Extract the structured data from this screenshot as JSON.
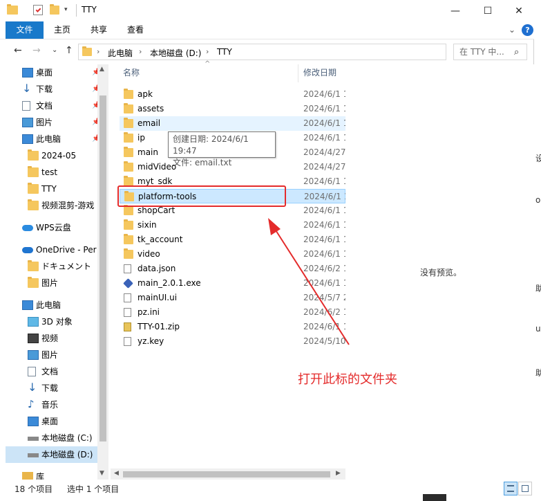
{
  "window": {
    "title": "TTY",
    "controls": {
      "minimize": "—",
      "maximize": "☐",
      "close": "✕"
    }
  },
  "ribbon": {
    "tabs": [
      {
        "label": "文件",
        "active": true
      },
      {
        "label": "主页",
        "active": false
      },
      {
        "label": "共享",
        "active": false
      },
      {
        "label": "查看",
        "active": false
      }
    ],
    "expand": "⌄",
    "help": "?"
  },
  "address": {
    "back": "←",
    "forward": "→",
    "recent": "⌄",
    "up": "↑",
    "breadcrumbs": [
      "此电脑",
      "本地磁盘 (D:)",
      "TTY"
    ],
    "separator": "›",
    "dropdown": "⌄",
    "refresh": "↻",
    "search_placeholder": "在 TTY 中...",
    "search_icon": "⌕"
  },
  "nav": {
    "items": [
      {
        "label": "桌面",
        "icon": "desktop-icon",
        "pinned": true
      },
      {
        "label": "下载",
        "icon": "download-icon",
        "pinned": true
      },
      {
        "label": "文档",
        "icon": "document-icon",
        "pinned": true
      },
      {
        "label": "图片",
        "icon": "picture-icon",
        "pinned": true
      },
      {
        "label": "此电脑",
        "icon": "computer-icon",
        "pinned": true
      },
      {
        "label": "2024-05",
        "icon": "folder-icon",
        "pinned": false
      },
      {
        "label": "test",
        "icon": "folder-icon",
        "pinned": false
      },
      {
        "label": "TTY",
        "icon": "folder-icon",
        "pinned": false
      },
      {
        "label": "视频混剪-游戏",
        "icon": "folder-icon",
        "pinned": false
      },
      {
        "label": "WPS云盘",
        "icon": "cloud-icon",
        "pinned": false
      },
      {
        "label": "OneDrive - Per",
        "icon": "onedrive-icon",
        "pinned": false
      },
      {
        "label": "ドキュメント",
        "icon": "folder-icon",
        "pinned": false
      },
      {
        "label": "图片",
        "icon": "folder-icon",
        "pinned": false
      },
      {
        "label": "此电脑",
        "icon": "computer-icon",
        "pinned": false
      },
      {
        "label": "3D 对象",
        "icon": "3d-objects-icon",
        "pinned": false
      },
      {
        "label": "视频",
        "icon": "video-icon",
        "pinned": false
      },
      {
        "label": "图片",
        "icon": "picture-icon",
        "pinned": false
      },
      {
        "label": "文档",
        "icon": "document-icon",
        "pinned": false
      },
      {
        "label": "下载",
        "icon": "download-icon",
        "pinned": false
      },
      {
        "label": "音乐",
        "icon": "music-icon",
        "pinned": false
      },
      {
        "label": "桌面",
        "icon": "desktop-icon",
        "pinned": false
      },
      {
        "label": "本地磁盘 (C:)",
        "icon": "drive-icon",
        "pinned": false
      },
      {
        "label": "本地磁盘 (D:)",
        "icon": "drive-icon",
        "pinned": false,
        "selected": true
      },
      {
        "label": "库",
        "icon": "library-icon",
        "pinned": false
      }
    ],
    "pin_glyph": "📌"
  },
  "filelist": {
    "columns": {
      "name": "名称",
      "date": "修改日期"
    },
    "sort_glyph": "^",
    "files": [
      {
        "name": "apk",
        "date": "2024/6/1 1",
        "type": "folder"
      },
      {
        "name": "assets",
        "date": "2024/6/1 1",
        "type": "folder"
      },
      {
        "name": "email",
        "date": "2024/6/1 1",
        "type": "folder",
        "state": "hover"
      },
      {
        "name": "ip",
        "date": "2024/6/1 1",
        "type": "folder"
      },
      {
        "name": "main",
        "date": "2024/4/27",
        "type": "folder"
      },
      {
        "name": "midVideo",
        "date": "2024/4/27",
        "type": "folder"
      },
      {
        "name": "myt_sdk",
        "date": "2024/6/1 1",
        "type": "folder"
      },
      {
        "name": "platform-tools",
        "date": "2024/6/1 1",
        "type": "folder",
        "state": "selected"
      },
      {
        "name": "shopCart",
        "date": "2024/6/1 1",
        "type": "folder"
      },
      {
        "name": "sixin",
        "date": "2024/6/1 1",
        "type": "folder"
      },
      {
        "name": "tk_account",
        "date": "2024/6/1 1",
        "type": "folder"
      },
      {
        "name": "video",
        "date": "2024/6/1 1",
        "type": "folder"
      },
      {
        "name": "data.json",
        "date": "2024/6/2 1",
        "type": "doc"
      },
      {
        "name": "main_2.0.1.exe",
        "date": "2024/6/1 1",
        "type": "exe"
      },
      {
        "name": "mainUI.ui",
        "date": "2024/5/7 2",
        "type": "doc"
      },
      {
        "name": "pz.ini",
        "date": "2024/6/2 1",
        "type": "doc"
      },
      {
        "name": "TTY-01.zip",
        "date": "2024/6/1 1",
        "type": "zip"
      },
      {
        "name": "yz.key",
        "date": "2024/5/10",
        "type": "doc"
      }
    ]
  },
  "tooltip": {
    "line1": "创建日期: 2024/6/1 19:47",
    "line2": "文件: email.txt"
  },
  "annotation": {
    "text": "打开此标的文件夹",
    "color": "#e42b2b"
  },
  "preview": {
    "text": "没有预览。"
  },
  "status": {
    "count": "18 个项目",
    "selected": "选中 1 个项目"
  },
  "background_chars": [
    "设",
    "o",
    "助",
    "u",
    "助"
  ],
  "colors": {
    "accent": "#1979ca",
    "selection": "#cce8ff",
    "folder": "#f5c75e"
  }
}
